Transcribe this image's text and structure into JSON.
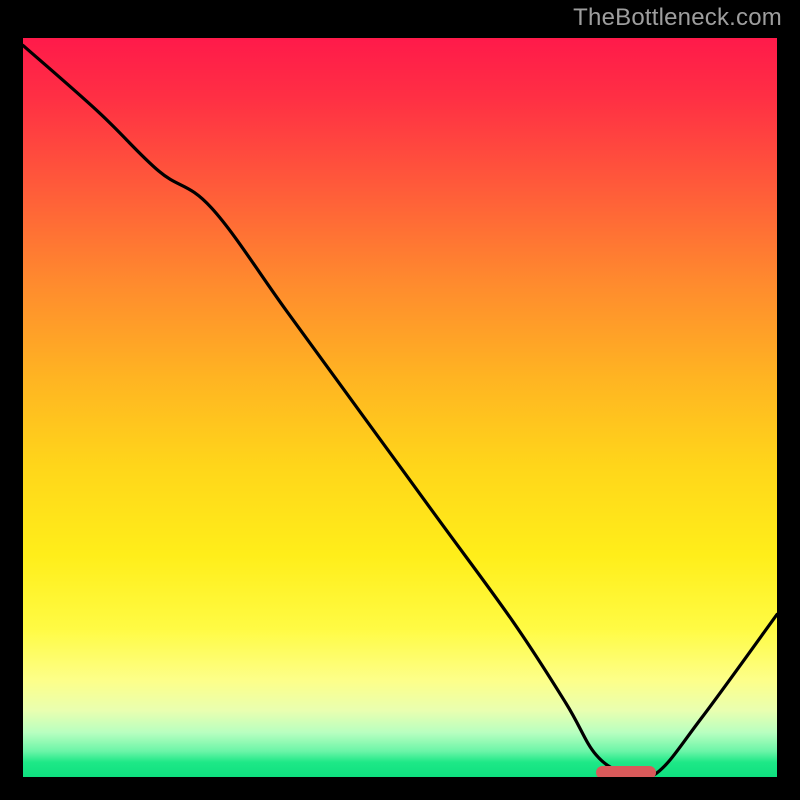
{
  "watermark": "TheBottleneck.com",
  "chart_data": {
    "type": "line",
    "title": "",
    "xlabel": "",
    "ylabel": "",
    "xlim": [
      0,
      100
    ],
    "ylim": [
      0,
      100
    ],
    "background_gradient": {
      "top": "#ff1a4a",
      "bottom": "#0ee07f",
      "meaning": "red=high bottleneck, green=low bottleneck"
    },
    "series": [
      {
        "name": "bottleneck-curve",
        "x": [
          0,
          10,
          18,
          25,
          35,
          45,
          55,
          65,
          72,
          76,
          80,
          84,
          90,
          100
        ],
        "y": [
          99,
          90,
          82,
          77,
          63,
          49,
          35,
          21,
          10,
          3,
          0.5,
          0.5,
          8,
          22
        ]
      }
    ],
    "marker": {
      "name": "optimal-range",
      "x_start": 76,
      "x_end": 84,
      "y": 0.7,
      "color": "#d85a5a"
    }
  },
  "colors": {
    "frame": "#000000",
    "curve": "#000000",
    "marker": "#d85a5a",
    "watermark": "#9e9e9e"
  }
}
